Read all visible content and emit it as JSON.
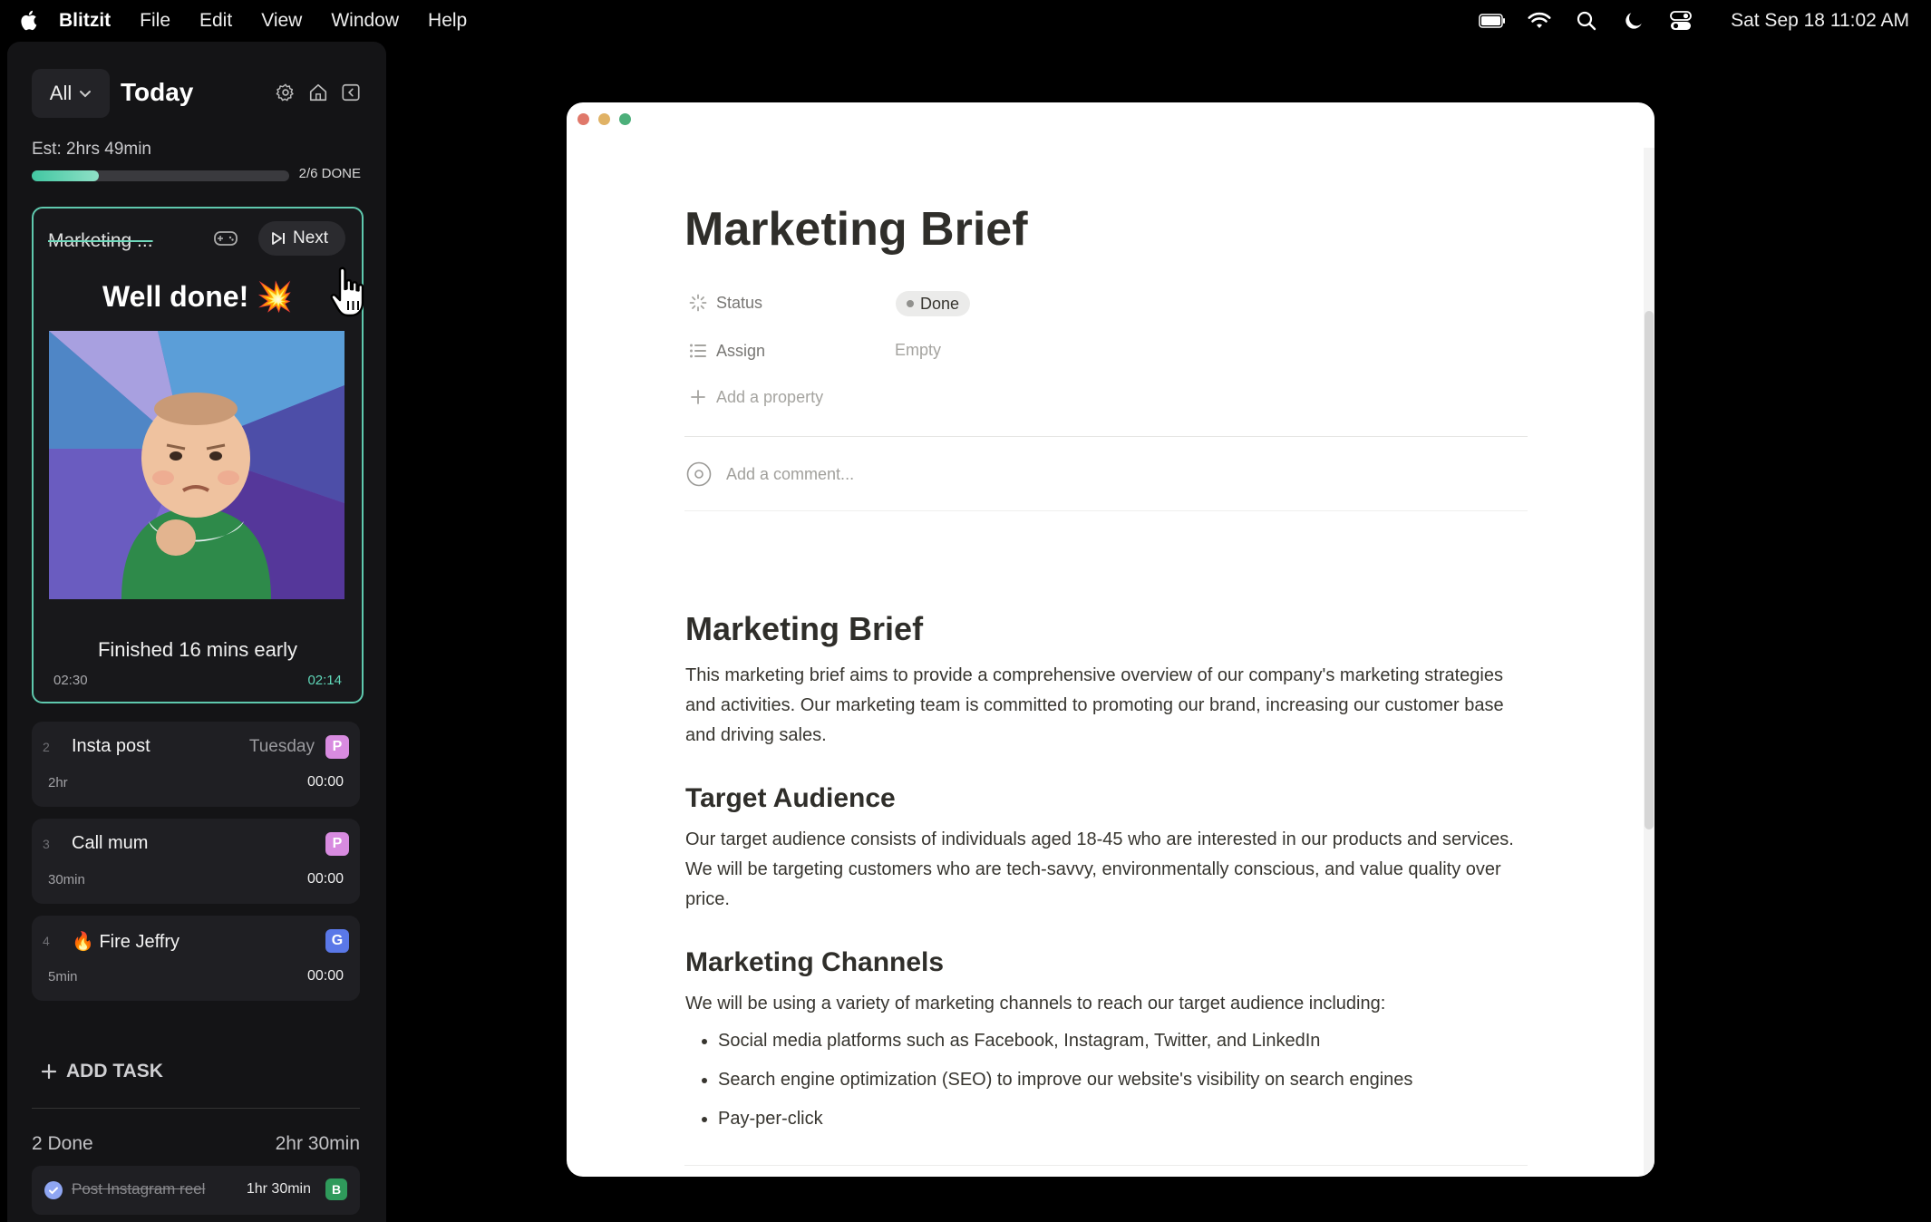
{
  "menubar": {
    "app_name": "Blitzit",
    "menus": [
      "File",
      "Edit",
      "View",
      "Window",
      "Help"
    ],
    "clock": "Sat Sep 18  11:02 AM",
    "status_icons": [
      "battery-icon",
      "wifi-icon",
      "search-icon",
      "moon-icon",
      "control-center-icon"
    ]
  },
  "sidebar": {
    "filter": "All",
    "title": "Today",
    "estimate": "Est: 2hrs 49min",
    "progress": {
      "fraction": 0.26,
      "label": "2/6 DONE"
    },
    "active_task": {
      "title": "Marketing ...",
      "next_label": "Next",
      "celebration": "Well done!",
      "emoji": "💥",
      "finished_text": "Finished 16 mins early",
      "time_planned": "02:30",
      "time_actual": "02:14"
    },
    "tasks": [
      {
        "num": "2",
        "name": "Insta post",
        "day": "Tuesday",
        "badge": "P",
        "badge_color": "#d88be0",
        "duration": "2hr",
        "timer": "00:00"
      },
      {
        "num": "3",
        "name": "Call mum",
        "day": "",
        "badge": "P",
        "badge_color": "#d88be0",
        "duration": "30min",
        "timer": "00:00"
      },
      {
        "num": "4",
        "name": "🔥 Fire Jeffry",
        "day": "",
        "badge": "G",
        "badge_color": "#5a78e8",
        "duration": "5min",
        "timer": "00:00"
      }
    ],
    "add_task_label": "ADD TASK",
    "done_section": {
      "label": "2 Done",
      "total_time": "2hr 30min",
      "items": [
        {
          "name": "Post Instagram reel",
          "time": "1hr 30min",
          "badge": "B"
        }
      ]
    }
  },
  "document": {
    "title": "Marketing Brief",
    "properties": [
      {
        "label": "Status",
        "value": "Done"
      },
      {
        "label": "Assign",
        "value": "Empty"
      }
    ],
    "add_property_label": "Add a property",
    "comment_placeholder": "Add a comment...",
    "heading": "Marketing Brief",
    "intro": "This marketing brief aims to provide a comprehensive overview of our company's marketing strategies and activities. Our marketing team is committed to promoting our brand, increasing our customer base and driving sales.",
    "section1_heading": "Target Audience",
    "section1_text": "Our target audience consists of individuals aged 18-45 who are interested in our products and services. We will be targeting customers who are tech-savvy, environmentally conscious, and value quality over price.",
    "section2_heading": "Marketing Channels",
    "section2_text": "We will be using a variety of marketing channels to reach our target audience including:",
    "bullets": [
      "Social media platforms such as Facebook, Instagram, Twitter, and LinkedIn",
      "Search engine optimization (SEO) to improve our website's visibility on search engines",
      "Pay-per-click"
    ]
  },
  "colors": {
    "accent": "#5fc9ae",
    "sidebar_bg": "#141416",
    "card_bg": "#1f1f23",
    "traffic_red": "#e0786a",
    "traffic_yellow": "#e0b265",
    "traffic_green": "#4caf7a"
  }
}
